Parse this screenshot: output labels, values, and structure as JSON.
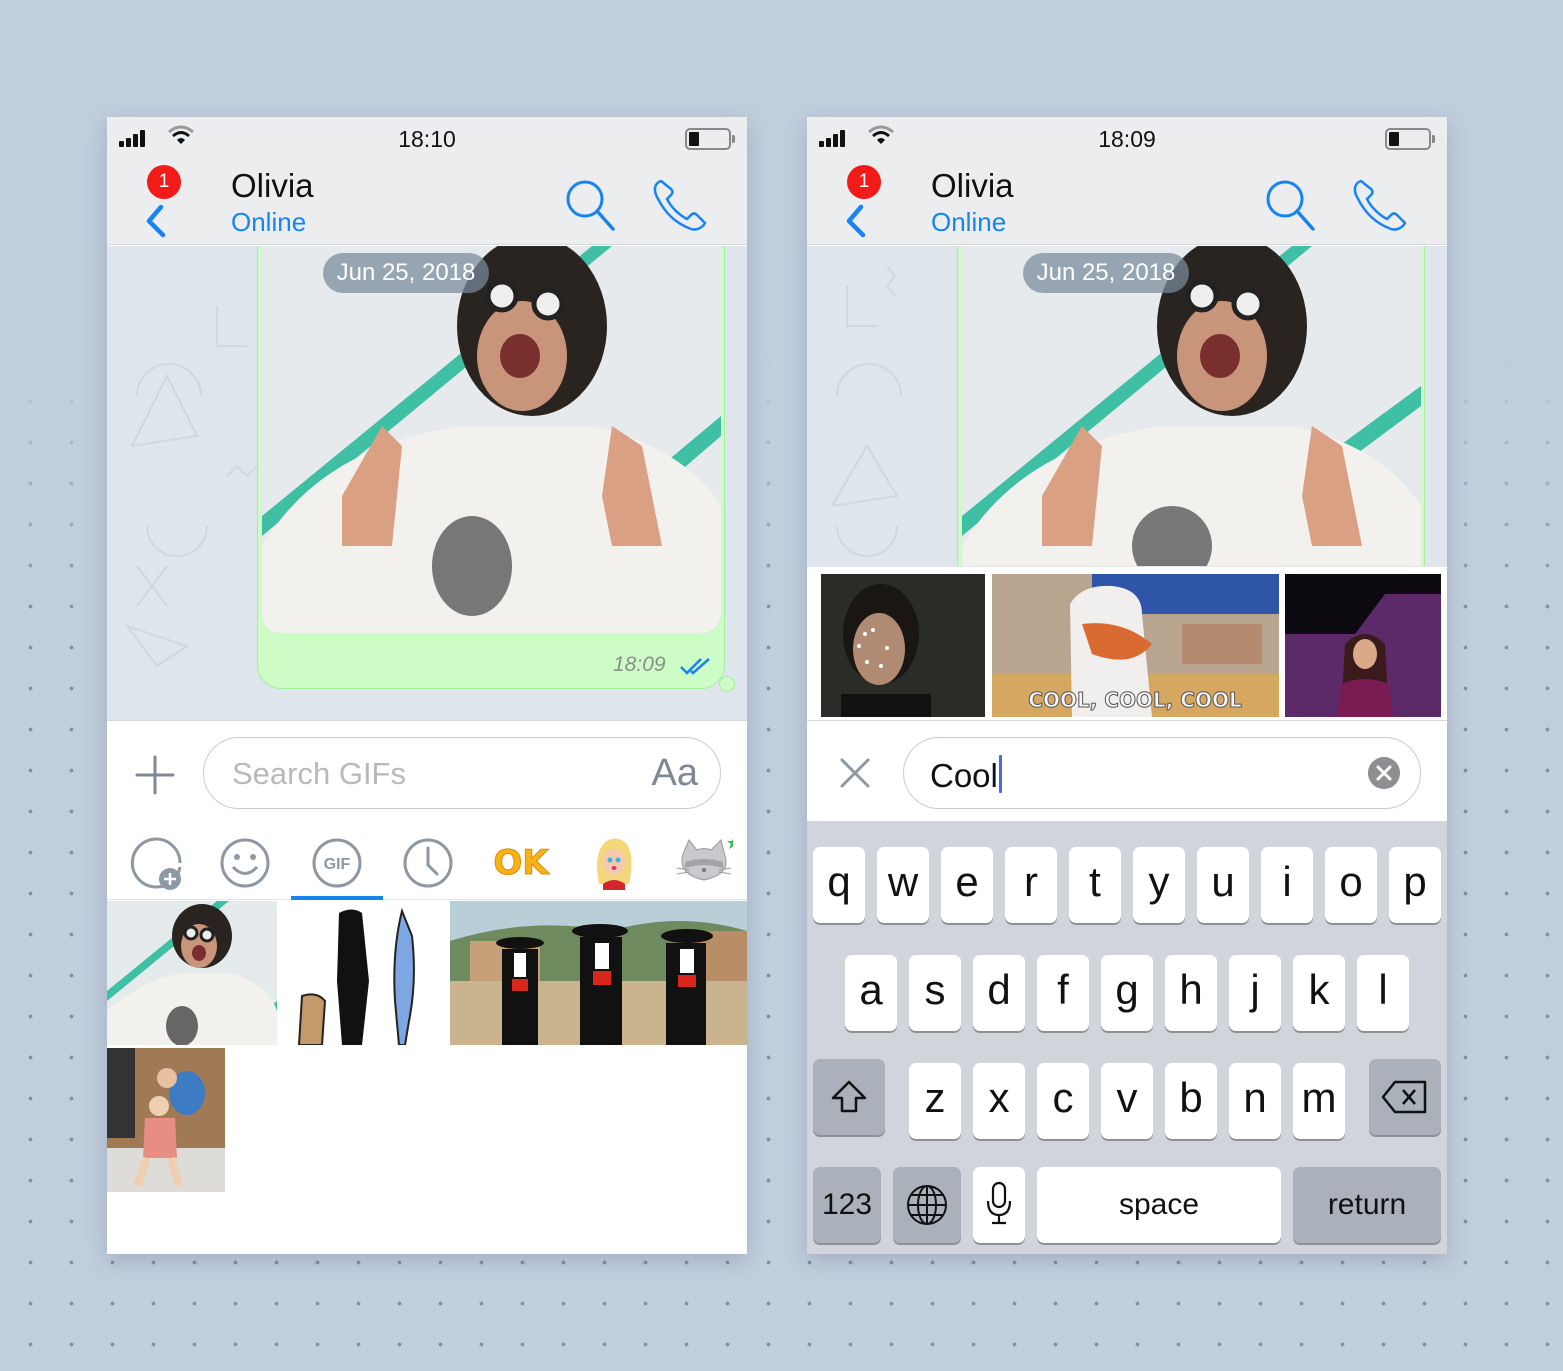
{
  "left_screen": {
    "status": {
      "time": "18:10"
    },
    "header": {
      "contact_name": "Olivia",
      "contact_status": "Online",
      "unread_badge": "1"
    },
    "chat": {
      "date_separator": "Jun 25, 2018",
      "message": {
        "type": "gif",
        "time": "18:09",
        "read_status": "double-check-read"
      }
    },
    "composer": {
      "search_placeholder": "Search GIFs",
      "text_style_button": "Aa",
      "add_icon": "plus-icon"
    },
    "tabs": [
      {
        "name": "add-sticker-tab",
        "icon": "sticker-add-icon"
      },
      {
        "name": "emoji-tab",
        "icon": "smiley-icon"
      },
      {
        "name": "gif-tab",
        "icon": "gif-icon",
        "label": "GIF",
        "active": true
      },
      {
        "name": "recent-tab",
        "icon": "clock-icon"
      },
      {
        "name": "ok-sticker-pack",
        "icon": "ok-sticker-icon",
        "label": "OK"
      },
      {
        "name": "girl-sticker-pack",
        "icon": "girl-sticker-icon"
      },
      {
        "name": "cat-sticker-pack",
        "icon": "cat-sticker-icon",
        "new_marker": "star"
      }
    ],
    "gif_results": [
      {
        "description": "man with googly glasses giving thumbs up"
      },
      {
        "description": "cartoon characters dancing"
      },
      {
        "description": "three men in sombreros"
      },
      {
        "description": "toddler dancing"
      }
    ]
  },
  "right_screen": {
    "status": {
      "time": "18:09"
    },
    "header": {
      "contact_name": "Olivia",
      "contact_status": "Online",
      "unread_badge": "1"
    },
    "chat": {
      "date_separator": "Jun 25, 2018"
    },
    "gif_results": [
      {
        "description": "smiling man"
      },
      {
        "description": "cartoon stork",
        "caption": "COOL, COOL, COOL"
      },
      {
        "description": "woman in purple dress"
      }
    ],
    "search": {
      "value": "Cool",
      "close_icon": "close-icon",
      "clear_icon": "clear-icon"
    },
    "keyboard": {
      "row1": [
        "q",
        "w",
        "e",
        "r",
        "t",
        "y",
        "u",
        "i",
        "o",
        "p"
      ],
      "row2": [
        "a",
        "s",
        "d",
        "f",
        "g",
        "h",
        "j",
        "k",
        "l"
      ],
      "row3": [
        "z",
        "x",
        "c",
        "v",
        "b",
        "n",
        "m"
      ],
      "numbers_key": "123",
      "space_key": "space",
      "return_key": "return"
    }
  },
  "colors": {
    "accent": "#1784f0",
    "badge": "#f31a1a",
    "bubble": "#cdfcc6",
    "background": "#c1cedd"
  }
}
